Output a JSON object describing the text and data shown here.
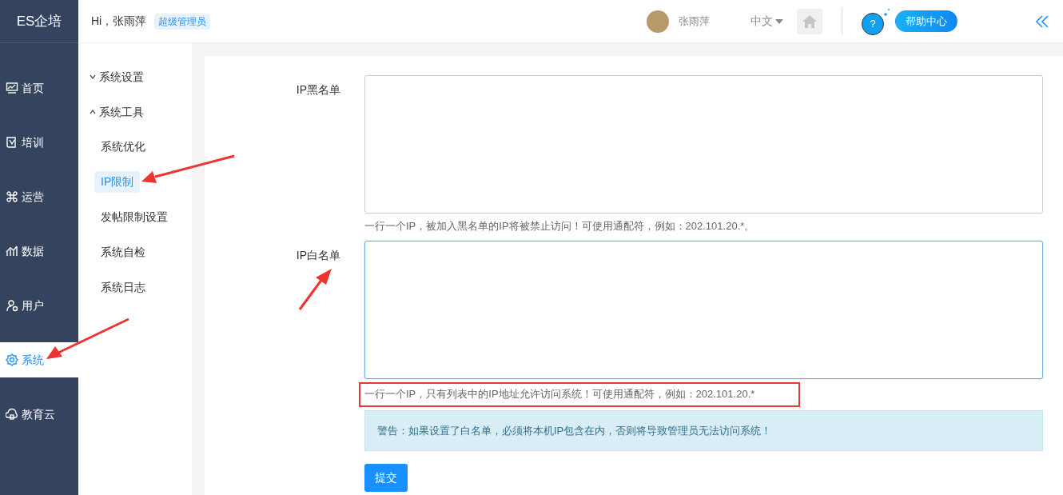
{
  "brand": "ES企培",
  "header": {
    "greeting": "Hi，张雨萍",
    "role_badge": "超级管理员",
    "user_name": "张雨萍",
    "language": "中文",
    "help_icon": "?",
    "help": "帮助中心"
  },
  "main_nav": [
    {
      "label": "首页",
      "selected": false
    },
    {
      "label": "培训",
      "selected": false
    },
    {
      "label": "运营",
      "selected": false
    },
    {
      "label": "数据",
      "selected": false
    },
    {
      "label": "用户",
      "selected": false
    },
    {
      "label": "系统",
      "selected": true
    },
    {
      "label": "教育云",
      "selected": false
    }
  ],
  "sub_nav": [
    {
      "label": "系统设置",
      "expanded": false
    },
    {
      "label": "系统工具",
      "expanded": true,
      "children": [
        {
          "label": "系统优化",
          "selected": false
        },
        {
          "label": "IP限制",
          "selected": true
        },
        {
          "label": "发帖限制设置",
          "selected": false
        },
        {
          "label": "系统自检",
          "selected": false
        },
        {
          "label": "系统日志",
          "selected": false
        }
      ]
    }
  ],
  "form": {
    "fields": [
      {
        "label": "IP黑名单",
        "focused": false,
        "hint": "一行一个IP，被加入黑名单的IP将被禁止访问！可使用通配符，例如：202.101.20.*。",
        "hint_highlighted": false
      },
      {
        "label": "IP白名单",
        "focused": true,
        "hint": "一行一个IP，只有列表中的IP地址允许访问系统！可使用通配符，例如：202.101.20.*",
        "hint_highlighted": true
      }
    ],
    "warning": "警告：如果设置了白名单，必须将本机IP包含在内，否则将导致管理员无法访问系统！",
    "submit": "提交"
  },
  "annotations": [
    {
      "kind": "arrow"
    },
    {
      "kind": "arrow"
    },
    {
      "kind": "arrow"
    }
  ]
}
